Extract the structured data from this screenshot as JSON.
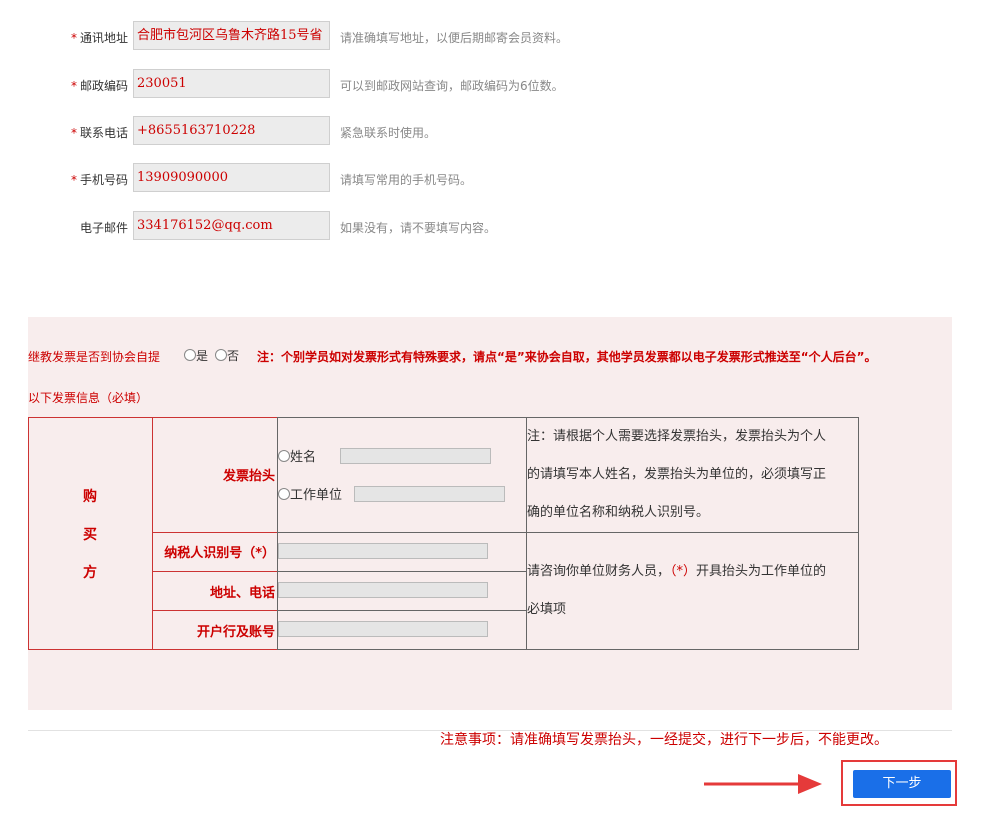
{
  "form": {
    "fields": [
      {
        "label": "通讯地址",
        "required": true,
        "value": "合肥市包河区乌鲁木齐路15号省",
        "hint": "请准确填写地址，以便后期邮寄会员资料。"
      },
      {
        "label": "邮政编码",
        "required": true,
        "value": "230051",
        "hint": "可以到邮政网站查询，邮政编码为6位数。"
      },
      {
        "label": "联系电话",
        "required": true,
        "value": "+8655163710228",
        "hint": "紧急联系时使用。"
      },
      {
        "label": "手机号码",
        "required": true,
        "value": "13909090000",
        "hint": "请填写常用的手机号码。"
      },
      {
        "label": "电子邮件",
        "required": false,
        "value": "334176152@qq.com",
        "hint": "如果没有，请不要填写内容。"
      }
    ],
    "required_mark": "*"
  },
  "invoice": {
    "pickup_question": "继教发票是否到协会自提",
    "option_yes": "是",
    "option_no": "否",
    "pickup_note": "注：个别学员如对发票形式有特殊要求，请点“是”来协会自取，其他学员发票都以电子发票形式推送至“个人后台”。",
    "section_title": "以下发票信息（必填）",
    "buyer_chars": [
      "购",
      "买",
      "方"
    ],
    "header_label": "发票抬头",
    "header_option_name": "姓名",
    "header_option_company": "工作单位",
    "header_note_lines": [
      "注：请根据个人需要选择发票抬头，发票抬头为个人",
      "的请填写本人姓名，发票抬头为单位的，必须填写正",
      "确的单位名称和纳税人识别号。"
    ],
    "tax_id_label": "纳税人识别号（*）",
    "address_label": "地址、电话",
    "bank_label": "开户行及账号",
    "consult_note_line1_a": "请咨询你单位财务人员，",
    "consult_note_line1_star": "（*）",
    "consult_note_line1_b": "开具抬头为工作单位的",
    "consult_note_line2": "必填项"
  },
  "footer": {
    "notice": "注意事项：请准确填写发票抬头，一经提交，进行下一步后，不能更改。",
    "next_label": "下一步"
  },
  "colors": {
    "accent_red": "#cc0000",
    "button_blue": "#1a6fe8",
    "panel_bg": "#f8eded"
  }
}
